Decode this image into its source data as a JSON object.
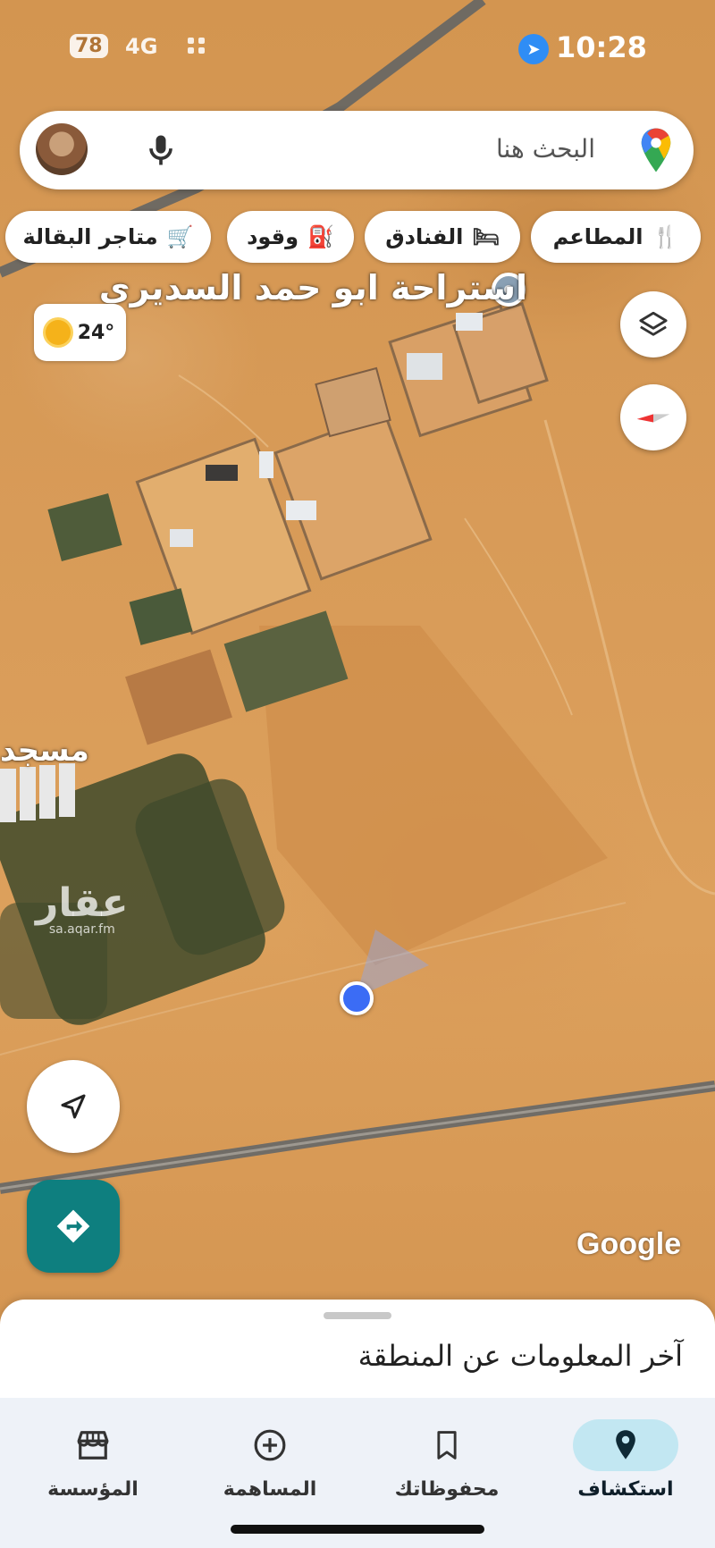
{
  "status_bar": {
    "battery": "78",
    "network": "4G",
    "time": "10:28"
  },
  "search": {
    "placeholder": "البحث هنا"
  },
  "chips": [
    {
      "label": "المطاعم",
      "icon": "restaurant-icon"
    },
    {
      "label": "الفنادق",
      "icon": "hotel-icon"
    },
    {
      "label": "وقود",
      "icon": "fuel-icon"
    },
    {
      "label": "متاجر البقالة",
      "icon": "cart-icon"
    }
  ],
  "map": {
    "place_label": "استراحة ابو حمد السديري",
    "mosque_label": "مسجد",
    "weather": "24°",
    "watermark_main": "عقار",
    "watermark_sub": "sa.aqar.fm",
    "google_logo": "Google"
  },
  "bottom_sheet": {
    "title": "آخر المعلومات عن المنطقة"
  },
  "nav": [
    {
      "label": "استكشاف",
      "icon": "explore-pin-icon",
      "active": true
    },
    {
      "label": "محفوظاتك",
      "icon": "bookmark-icon",
      "active": false
    },
    {
      "label": "المساهمة",
      "icon": "add-circle-icon",
      "active": false
    },
    {
      "label": "المؤسسة",
      "icon": "storefront-icon",
      "active": false
    }
  ],
  "colors": {
    "accent": "#0e7f7f",
    "location_dot": "#3b6cf5",
    "nav_active": "#c2e7f2",
    "map_sand": "#d79a55"
  }
}
